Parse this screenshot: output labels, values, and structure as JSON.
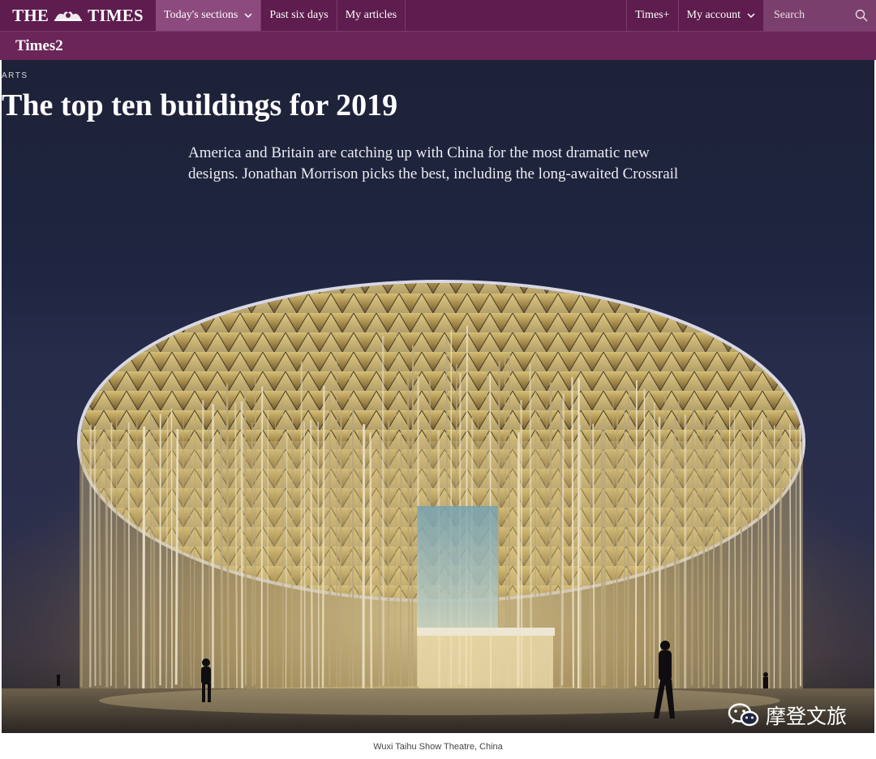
{
  "nav": {
    "logo_text": "THE TIMES",
    "logo_left": "THE",
    "logo_right": "TIMES",
    "items": [
      "Today's sections",
      "Past six days",
      "My articles"
    ],
    "times_plus": "Times+",
    "account": "My account",
    "search_placeholder": "Search"
  },
  "section": {
    "title": "Times2"
  },
  "article": {
    "kicker": "ARTS",
    "headline": "The top ten buildings for 2019",
    "standfirst": "America and Britain are catching up with China for the most dramatic new designs. Jonathan Morrison picks the best, including the long-awaited Crossrail",
    "caption": "Wuxi Taihu Show Theatre, China"
  },
  "watermark": {
    "text": "摩登文旅",
    "icon": "wechat-icon"
  },
  "colors": {
    "nav_bg": "#5e1d4e",
    "nav_active": "#8c4a7e",
    "section_bg": "#6b2559",
    "hero_bg": "#1f2540",
    "gold": "#d9c27a"
  }
}
